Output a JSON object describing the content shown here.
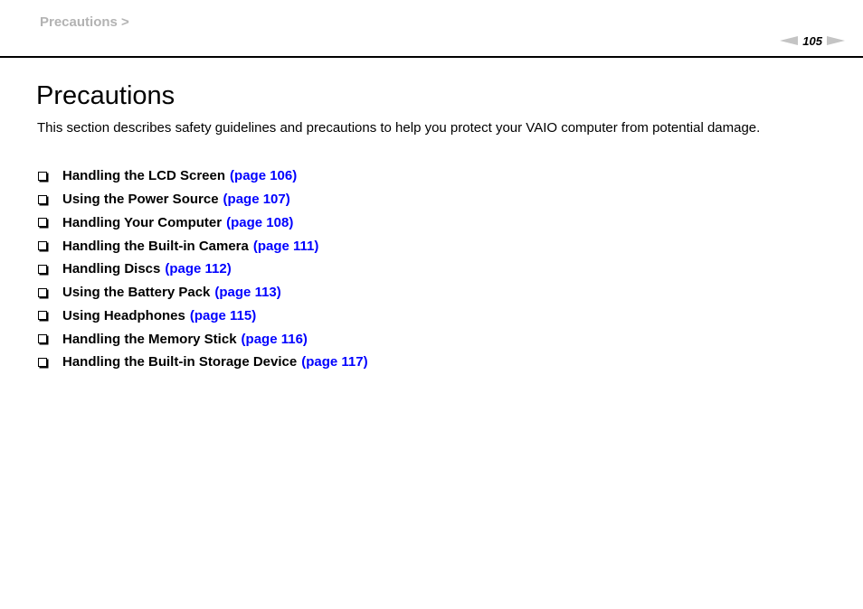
{
  "header": {
    "breadcrumb": "Precautions >",
    "page_number": "105",
    "prev_icon": "arrow-left-icon",
    "next_icon": "arrow-right-icon"
  },
  "main": {
    "title": "Precautions",
    "intro": "This section describes safety guidelines and precautions to help you protect your VAIO computer from potential damage.",
    "bullet_icon": "checkbox-bullet-icon",
    "link_color": "#0000ff",
    "items": [
      {
        "label": "Handling the LCD Screen",
        "link": "(page 106)"
      },
      {
        "label": "Using the Power Source",
        "link": "(page 107)"
      },
      {
        "label": "Handling Your Computer",
        "link": "(page 108)"
      },
      {
        "label": "Handling the Built-in Camera",
        "link": "(page 111)"
      },
      {
        "label": "Handling Discs",
        "link": "(page 112)"
      },
      {
        "label": "Using the Battery Pack",
        "link": "(page 113)"
      },
      {
        "label": "Using Headphones",
        "link": "(page 115)"
      },
      {
        "label": "Handling the Memory Stick",
        "link": "(page 116)"
      },
      {
        "label": "Handling the Built-in Storage Device",
        "link": "(page 117)"
      }
    ]
  }
}
